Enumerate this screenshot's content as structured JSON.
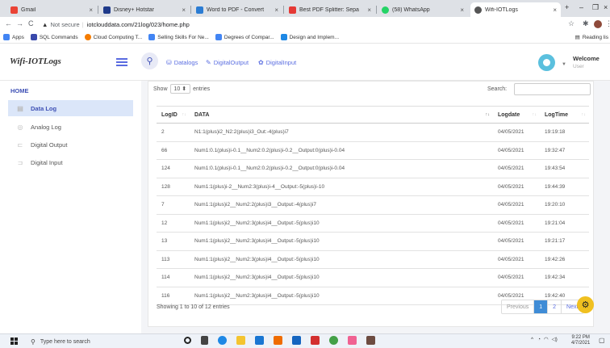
{
  "browser": {
    "tabs": [
      {
        "title": "Gmail",
        "color": "#ea4335",
        "active": false
      },
      {
        "title": "Disney+ Hotstar",
        "color": "#1f3a8a",
        "active": false
      },
      {
        "title": "Word to PDF - Convert",
        "color": "#2b7cd3",
        "active": false
      },
      {
        "title": "Best PDF Splitter: Sepa",
        "color": "#e53935",
        "active": false
      },
      {
        "title": "(58) WhatsApp",
        "color": "#25d366",
        "active": false
      },
      {
        "title": "Wifi-IOTLogs",
        "color": "#555555",
        "active": true
      }
    ],
    "security_label": "Not secure",
    "url": "iotclouddata.com/21log/023/home.php",
    "bookmarks": [
      {
        "label": "Apps",
        "color": "#4285f4"
      },
      {
        "label": "SQL Commands",
        "color": "#3949ab"
      },
      {
        "label": "Cloud Computing T...",
        "color": "#f57c00"
      },
      {
        "label": "Selling Skills For Ne...",
        "color": "#4285f4"
      },
      {
        "label": "Degrees of Compar...",
        "color": "#4285f4"
      },
      {
        "label": "Design and Implem...",
        "color": "#1e88e5"
      }
    ],
    "reading_list": "Reading lis"
  },
  "app": {
    "logo": "Wifi-IOTLogs",
    "topnav": [
      {
        "label": "Datalogs",
        "icon": "database-icon"
      },
      {
        "label": "DigitalOutput",
        "icon": "edit-icon"
      },
      {
        "label": "DigitalInput",
        "icon": "gear-icon"
      }
    ],
    "welcome": "Welcome",
    "user": "User"
  },
  "sidebar": {
    "heading": "HOME",
    "items": [
      {
        "label": "Data Log",
        "icon": "list-icon",
        "active": true
      },
      {
        "label": "Analog Log",
        "icon": "gauge-icon",
        "active": false
      },
      {
        "label": "Digital Output",
        "icon": "output-icon",
        "active": false
      },
      {
        "label": "Digital Input",
        "icon": "input-icon",
        "active": false
      }
    ]
  },
  "table": {
    "show_label": "Show",
    "entries_value": "10",
    "entries_label": "entries",
    "search_label": "Search:",
    "columns": [
      "LogID",
      "DATA",
      "Logdate",
      "LogTime"
    ],
    "rows": [
      [
        "2",
        "N1:1(plus)i2_N2:2(plus)i3_Out:-4(plus)i7",
        "04/05/2021",
        "19:19:18"
      ],
      [
        "66",
        "Num1:0.1(plus)i-0.1__Num2:0.2(plus)i-0.2__Output:0(plus)i-0.04",
        "04/05/2021",
        "19:32:47"
      ],
      [
        "124",
        "Num1:0.1(plus)i-0.1__Num2:0.2(plus)i-0.2__Output:0(plus)i-0.04",
        "04/05/2021",
        "19:43:54"
      ],
      [
        "128",
        "Num1:1(plus)i-2__Num2:3(plus)i-4__Output:-5(plus)i-10",
        "04/05/2021",
        "19:44:39"
      ],
      [
        "7",
        "Num1:1(plus)i2__Num2:2(plus)i3__Output:-4(plus)i7",
        "04/05/2021",
        "19:20:10"
      ],
      [
        "12",
        "Num1:1(plus)i2__Num2:3(plus)i4__Output:-5(plus)i10",
        "04/05/2021",
        "19:21:04"
      ],
      [
        "13",
        "Num1:1(plus)i2__Num2:3(plus)i4__Output:-5(plus)i10",
        "04/05/2021",
        "19:21:17"
      ],
      [
        "113",
        "Num1:1(plus)i2__Num2:3(plus)i4__Output:-5(plus)i10",
        "04/05/2021",
        "19:42:26"
      ],
      [
        "114",
        "Num1:1(plus)i2__Num2:3(plus)i4__Output:-5(plus)i10",
        "04/05/2021",
        "19:42:34"
      ],
      [
        "116",
        "Num1:1(plus)i2__Num2:3(plus)i4__Output:-5(plus)i10",
        "04/05/2021",
        "19:42:40"
      ]
    ],
    "info": "Showing 1 to 10 of 12 entries",
    "pagination": {
      "previous": "Previous",
      "pages": [
        "1",
        "2"
      ],
      "current": "1",
      "next": "Next"
    }
  },
  "taskbar": {
    "search_placeholder": "Type here to search",
    "time": "9:22 PM",
    "date": "4/7/2021"
  }
}
